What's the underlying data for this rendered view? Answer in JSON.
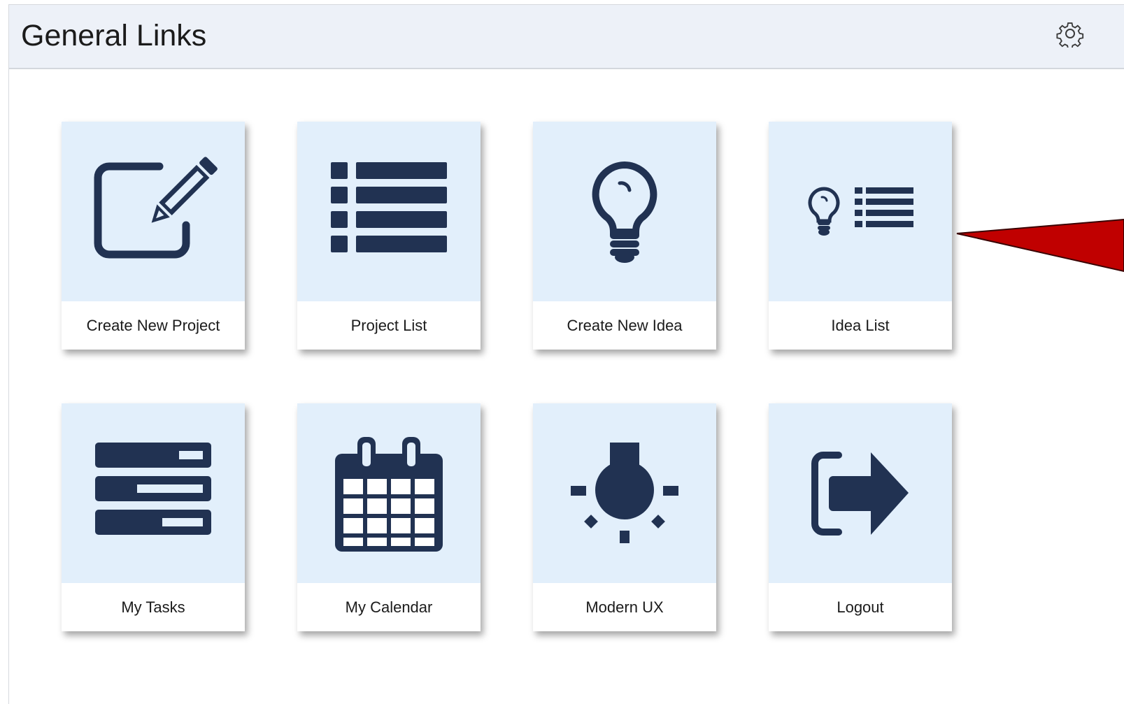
{
  "header": {
    "title": "General Links",
    "settings_icon": "gear-icon"
  },
  "tiles": [
    {
      "label": "Create New Project",
      "icon": "edit-icon"
    },
    {
      "label": "Project List",
      "icon": "list-icon"
    },
    {
      "label": "Create New Idea",
      "icon": "lightbulb-icon"
    },
    {
      "label": "Idea List",
      "icon": "idea-list-icon"
    },
    {
      "label": "My Tasks",
      "icon": "tasks-icon"
    },
    {
      "label": "My Calendar",
      "icon": "calendar-icon"
    },
    {
      "label": "Modern UX",
      "icon": "bright-bulb-icon"
    },
    {
      "label": "Logout",
      "icon": "logout-icon"
    }
  ],
  "colors": {
    "icon": "#213252",
    "tile_background": "#e2effb",
    "header_background": "#edf1f8",
    "annotation_arrow": "#c00000"
  }
}
